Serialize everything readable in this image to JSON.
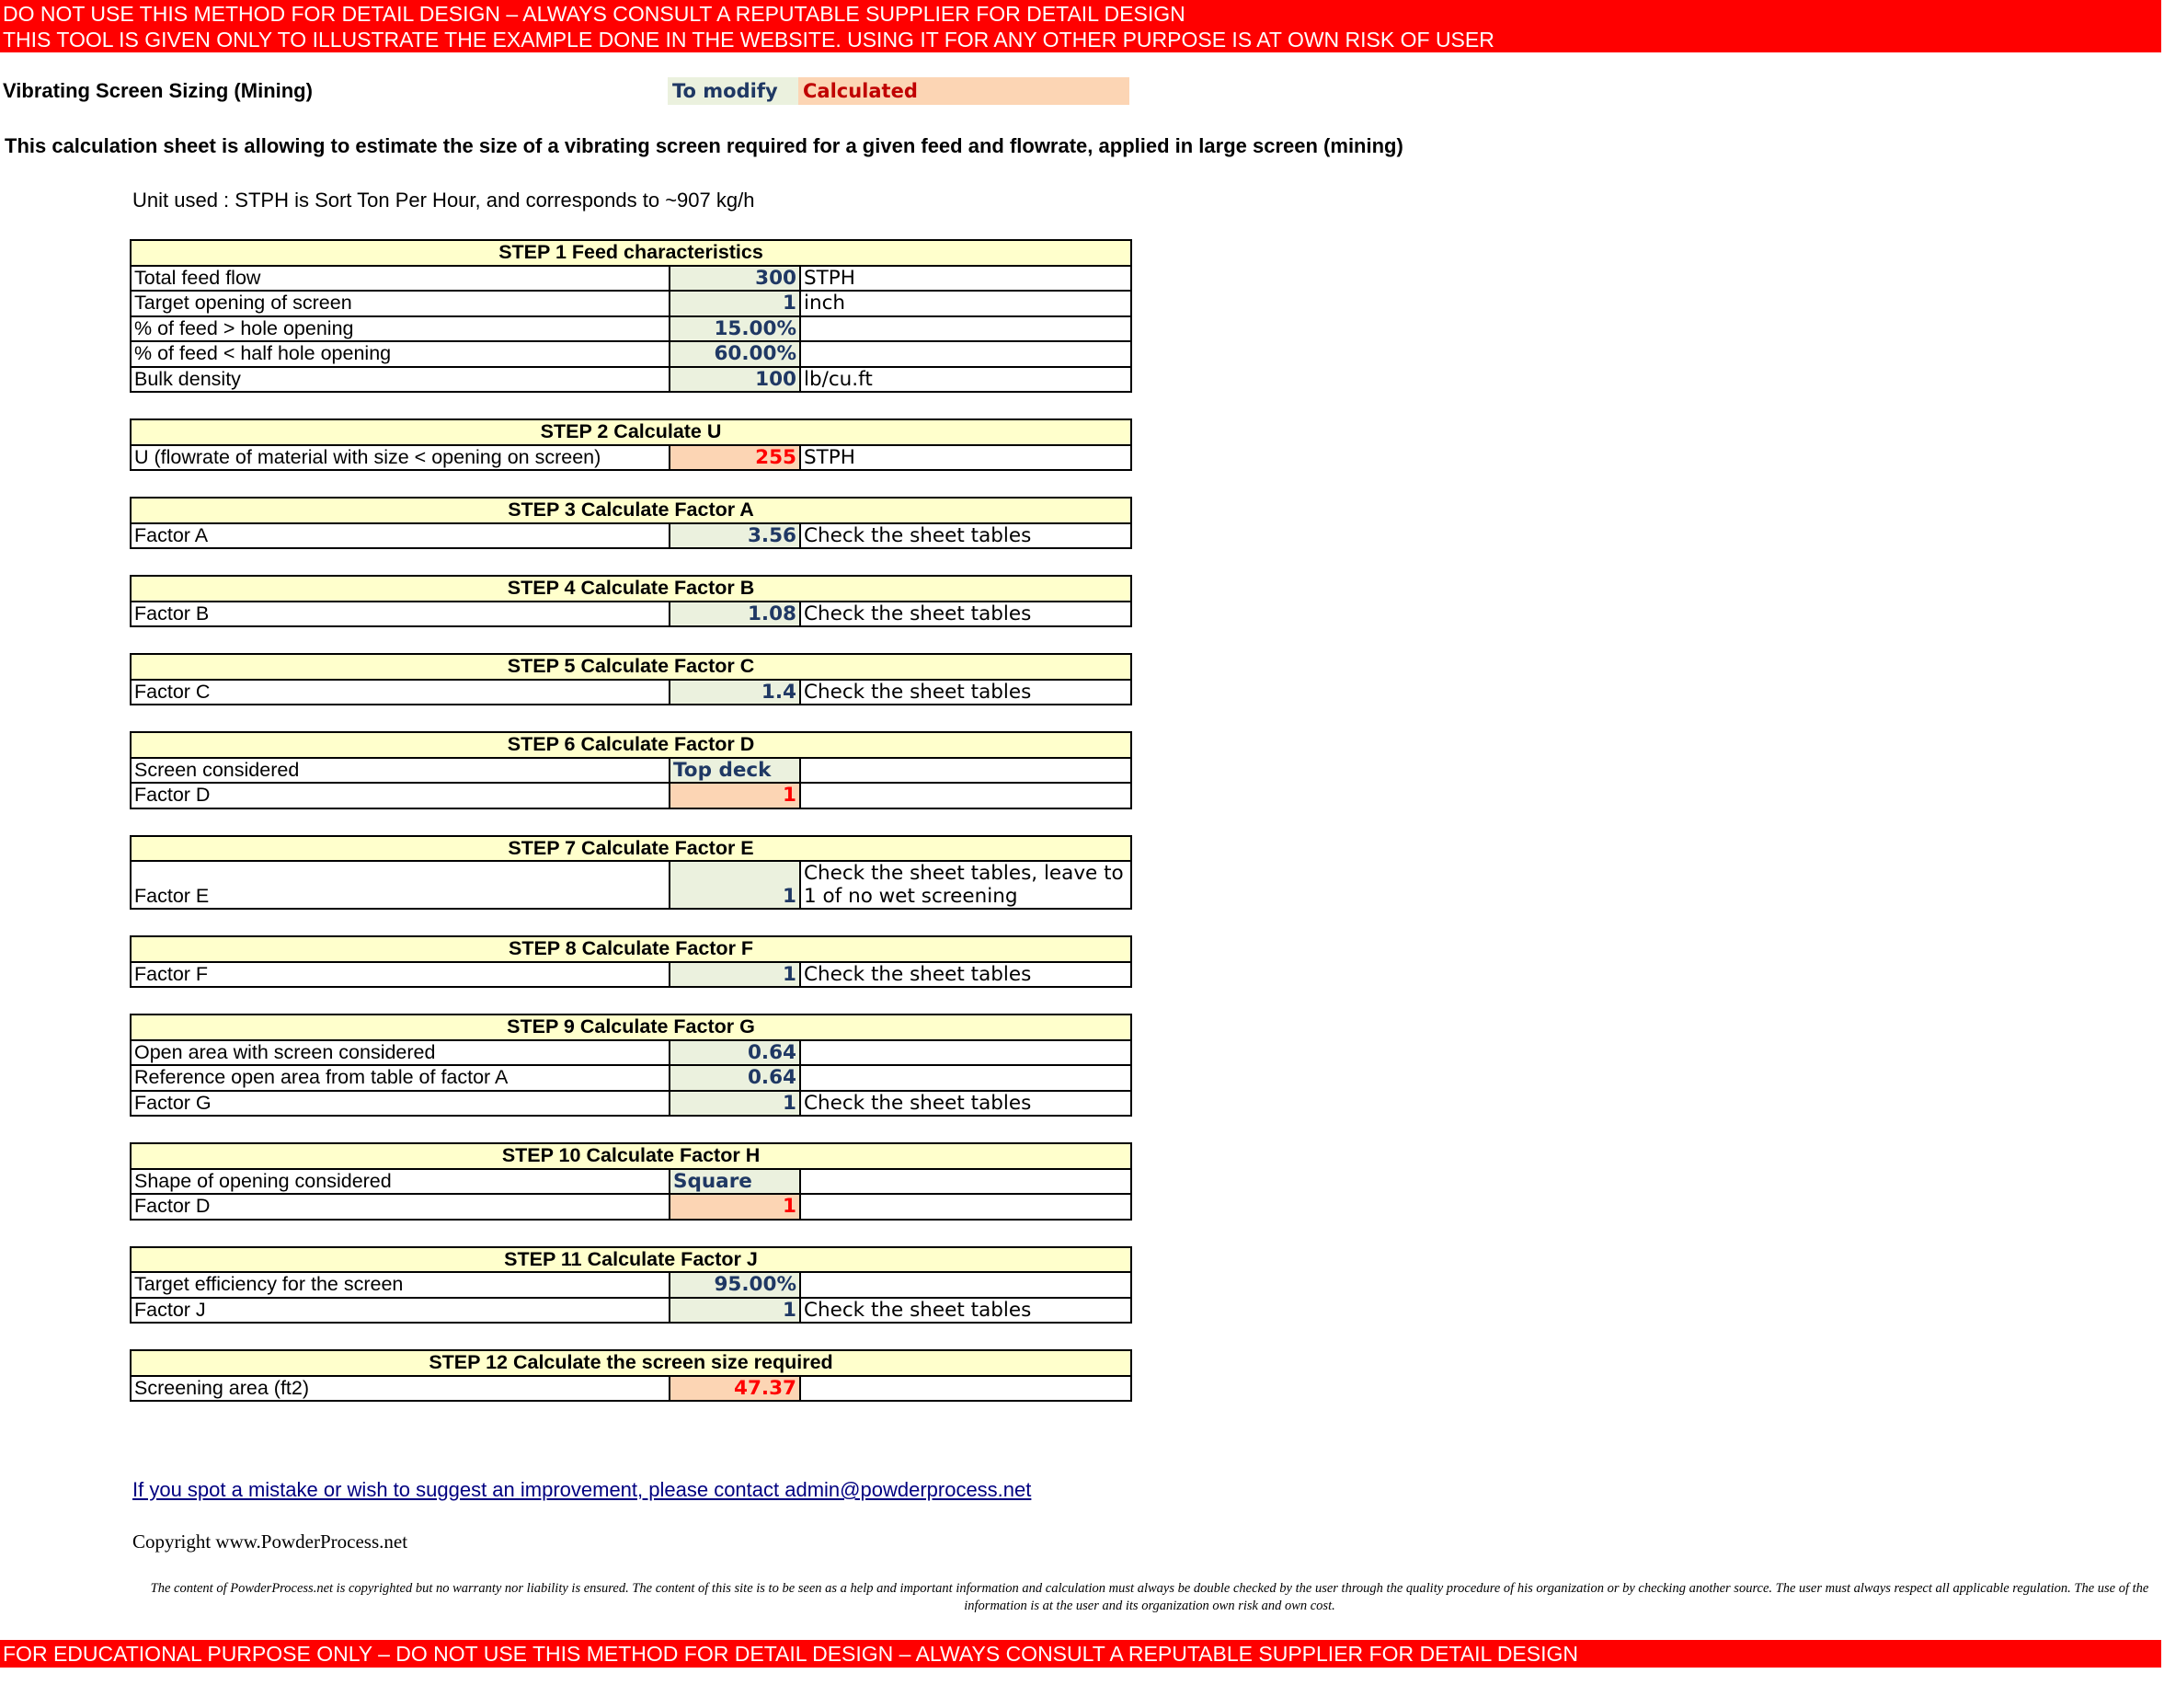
{
  "banner_top": {
    "line1": "DO NOT USE THIS METHOD FOR DETAIL DESIGN – ALWAYS CONSULT A REPUTABLE SUPPLIER FOR DETAIL DESIGN",
    "line2": "THIS TOOL IS GIVEN ONLY TO ILLUSTRATE THE EXAMPLE DONE IN THE WEBSITE. USING IT FOR ANY OTHER PURPOSE IS AT OWN RISK OF USER"
  },
  "sheet_title": "Vibrating Screen Sizing (Mining)",
  "legend": {
    "modify": "To modify",
    "calculated": "Calculated"
  },
  "intro": "This calculation sheet is allowing to estimate the size of a vibrating screen required for a given feed and flowrate, applied in large screen (mining)",
  "unit_note": "Unit used : STPH is Sort Ton Per Hour, and corresponds to ~907 kg/h",
  "steps": {
    "s1": {
      "title": "STEP 1 Feed characteristics",
      "rows": [
        {
          "label": "Total feed flow",
          "value": "300",
          "unit": "STPH"
        },
        {
          "label": "Target opening of screen",
          "value": "1",
          "unit": "inch"
        },
        {
          "label": "% of feed > hole opening",
          "value": "15.00%",
          "unit": ""
        },
        {
          "label": "% of feed < half hole opening",
          "value": "60.00%",
          "unit": ""
        },
        {
          "label": "Bulk density",
          "value": "100",
          "unit": "lb/cu.ft"
        }
      ]
    },
    "s2": {
      "title": "STEP 2 Calculate U",
      "rows": [
        {
          "label": "U (flowrate of material with size < opening on screen)",
          "value": "255",
          "unit": "STPH"
        }
      ]
    },
    "s3": {
      "title": "STEP 3 Calculate Factor A",
      "rows": [
        {
          "label": "Factor A",
          "value": "3.56",
          "unit": "Check the sheet tables"
        }
      ]
    },
    "s4": {
      "title": "STEP 4 Calculate Factor B",
      "rows": [
        {
          "label": "Factor B",
          "value": "1.08",
          "unit": "Check the sheet tables"
        }
      ]
    },
    "s5": {
      "title": "STEP 5 Calculate Factor C",
      "rows": [
        {
          "label": "Factor C",
          "value": "1.4",
          "unit": "Check the sheet tables"
        }
      ]
    },
    "s6": {
      "title": "STEP 6 Calculate Factor D",
      "rows": [
        {
          "label": "Screen considered",
          "value": "Top deck",
          "unit": ""
        },
        {
          "label": "Factor D",
          "value": "1",
          "unit": ""
        }
      ]
    },
    "s7": {
      "title": "STEP 7 Calculate Factor E",
      "rows": [
        {
          "label": "Factor E",
          "value": "1",
          "unit": "Check the sheet tables, leave to 1 of no wet screening"
        }
      ]
    },
    "s8": {
      "title": "STEP 8 Calculate Factor F",
      "rows": [
        {
          "label": "Factor F",
          "value": "1",
          "unit": "Check the sheet tables"
        }
      ]
    },
    "s9": {
      "title": "STEP 9 Calculate Factor G",
      "rows": [
        {
          "label": "Open area with screen considered",
          "value": "0.64",
          "unit": ""
        },
        {
          "label": "Reference open area from table of factor A",
          "value": "0.64",
          "unit": ""
        },
        {
          "label": "Factor G",
          "value": "1",
          "unit": "Check the sheet tables"
        }
      ]
    },
    "s10": {
      "title": "STEP 10 Calculate Factor H",
      "rows": [
        {
          "label": "Shape of opening considered",
          "value": "Square",
          "unit": ""
        },
        {
          "label": "Factor D",
          "value": "1",
          "unit": ""
        }
      ]
    },
    "s11": {
      "title": "STEP 11 Calculate Factor J",
      "rows": [
        {
          "label": "Target efficiency for the screen",
          "value": "95.00%",
          "unit": ""
        },
        {
          "label": "Factor J",
          "value": "1",
          "unit": "Check the sheet tables"
        }
      ]
    },
    "s12": {
      "title": "STEP 12 Calculate the screen size required",
      "rows": [
        {
          "label": "Screening area (ft2)",
          "value": "47.37",
          "unit": ""
        }
      ]
    }
  },
  "contact_link": "If you spot a mistake or wish to suggest an improvement, please contact admin@powderprocess.net",
  "copyright": "Copyright www.PowderProcess.net",
  "disclaimer": "The content of PowderProcess.net is copyrighted but no warranty nor liability is ensured. The content of this site is to be seen as a help and important information and calculation must always be double checked by the user through the quality procedure of his organization or by checking another source. The user must always respect all applicable regulation. The use of the information is at the user and its organization own risk and own cost.",
  "banner_bottom": "FOR EDUCATIONAL PURPOSE ONLY – DO NOT USE THIS METHOD FOR DETAIL DESIGN – ALWAYS CONSULT A REPUTABLE SUPPLIER FOR DETAIL DESIGN",
  "colors": {
    "banner": "#ff0000",
    "input_cell": "#ebf1de",
    "calc_cell": "#fcd5b4",
    "header": "#ffffcc"
  }
}
